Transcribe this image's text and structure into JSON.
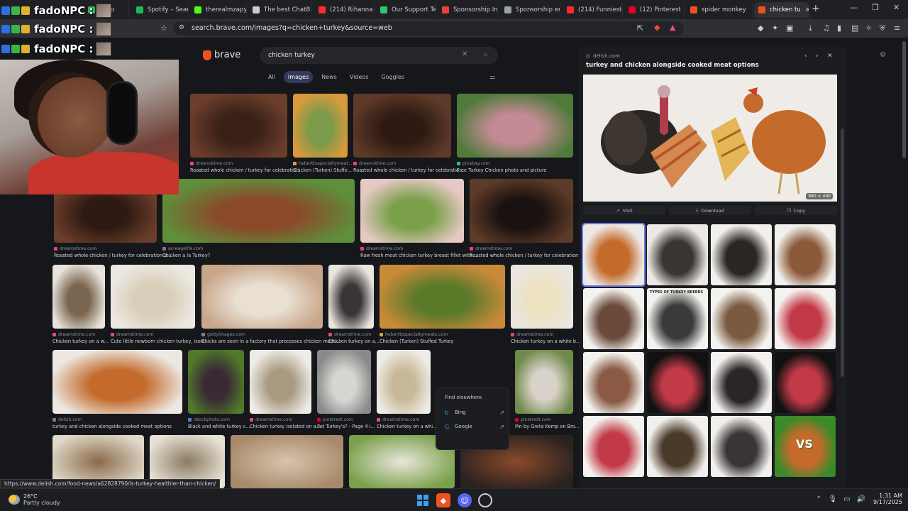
{
  "browser": {
    "tabs": [
      {
        "label": "sApp",
        "icon": "whatsapp-icon",
        "color": "#2fb65f"
      },
      {
        "label": "Spotify – Search",
        "icon": "spotify-icon",
        "color": "#1db954"
      },
      {
        "label": "therealmzapy S",
        "icon": "kick-icon",
        "color": "#53fc18"
      },
      {
        "label": "The best ChatB",
        "icon": "chatbot-icon",
        "color": "#cccccc"
      },
      {
        "label": "(214) Rihanna",
        "icon": "youtube-icon",
        "color": "#ff2b2b"
      },
      {
        "label": "Our Support Te",
        "icon": "support-icon",
        "color": "#32c36c"
      },
      {
        "label": "Sponsorship In",
        "icon": "gmail-icon",
        "color": "#ea4335"
      },
      {
        "label": "Sponsorship en",
        "icon": "globe-icon",
        "color": "#9aa0a6"
      },
      {
        "label": "(214) Funniest",
        "icon": "youtube-icon",
        "color": "#ff2b2b"
      },
      {
        "label": "(12) Pinterest",
        "icon": "pinterest-icon",
        "color": "#e60023"
      },
      {
        "label": "spider monkey",
        "icon": "brave-search-icon",
        "color": "#f0521f"
      },
      {
        "label": "chicken tu",
        "icon": "brave-search-icon",
        "color": "#f0521f",
        "active": true
      }
    ],
    "new_tab": "+",
    "window_controls": [
      "—",
      "❐",
      "✕"
    ],
    "url": "search.brave.com/images?q=chicken+turkey&source=web"
  },
  "overlay": {
    "name": "fadoNPC :"
  },
  "brave": {
    "logo_text": "brave",
    "query": "chicken turkey",
    "filters": [
      "All",
      "Images",
      "News",
      "Videos",
      "Goggles"
    ],
    "active_filter": "Images"
  },
  "results": [
    {
      "src": "dreamstime.com",
      "title": "Roasted whole chicken / turkey for celebratio...",
      "src_color": "#e8467c"
    },
    {
      "src": "heberttsspecialtymeat...",
      "title": "Chicken (Turken) Stuffe...",
      "src_color": "#d9a23a"
    },
    {
      "src": "dreamstime.com",
      "title": "Roasted whole chicken / turkey for celebratio...",
      "src_color": "#e8467c"
    },
    {
      "src": "pixabay.com",
      "title": "Free Turkey Chicken photo and picture",
      "src_color": "#2ec66d"
    },
    {
      "src": "dreamstime.com",
      "title": "Roasted whole chicken / turkey for celebration a...",
      "src_color": "#e8467c"
    },
    {
      "src": "acreagelife.com",
      "title": "Chicken a la Turkey?",
      "src_color": "#7a7d83"
    },
    {
      "src": "dreamstime.com",
      "title": "Raw fresh meat chicken turkey breast fillet with ...",
      "src_color": "#e8467c"
    },
    {
      "src": "dreamstime.com",
      "title": "Roasted whole chicken / turkey for celebration a...",
      "src_color": "#e8467c"
    },
    {
      "src": "dreamstime.com",
      "title": "Chicken turkey on a w...",
      "src_color": "#e8467c"
    },
    {
      "src": "dreamstime.com",
      "title": "Cute little newborn chicken turkey, isola...",
      "src_color": "#e8467c"
    },
    {
      "src": "gettyimages.com",
      "title": "Chicks are seen in a factory that processes chicken meat...",
      "src_color": "#7a7d83"
    },
    {
      "src": "dreamstime.com",
      "title": "Chicken turkey on a...",
      "src_color": "#e8467c"
    },
    {
      "src": "heberttsspecialtymeats.com",
      "title": "Chicken (Turken) Stuffed Turkey",
      "src_color": "#d9a23a"
    },
    {
      "src": "dreamstime.com",
      "title": "Chicken turkey on a white b...",
      "src_color": "#e8467c"
    },
    {
      "src": "delish.com",
      "title": "turkey and chicken alongside cooked meat options",
      "src_color": "#7a7d83"
    },
    {
      "src": "istockphoto.com",
      "title": "Black and white turkey c...",
      "src_color": "#5a7bd8"
    },
    {
      "src": "dreamstime.com",
      "title": "Chicken turkey isolated on a...",
      "src_color": "#e8467c"
    },
    {
      "src": "pinterest.com",
      "title": "Pet Turkey's? - Page 4 i...",
      "src_color": "#e60023"
    },
    {
      "src": "dreamstime.com",
      "title": "Chicken turkey on a whi...",
      "src_color": "#e8467c"
    },
    {
      "src": "pinterest.com",
      "title": "Pin by Greta Kemp on Bro...",
      "src_color": "#e60023"
    }
  ],
  "find_elsewhere": {
    "title": "Find elsewhere",
    "engines": [
      "Bing",
      "Google"
    ]
  },
  "preview": {
    "domain": "delish.com",
    "title": "turkey and chicken alongside cooked meat options",
    "dimensions": "980 × 490",
    "actions": [
      "Visit",
      "Download",
      "Copy"
    ],
    "vs_label": "VS",
    "breeds_label": "TYPES OF TURKEY BREEDS"
  },
  "status_url": "https://www.delish.com/food-news/a62828790/is-turkey-healthier-than-chicken/",
  "taskbar": {
    "temperature": "26°C",
    "weather": "Partly cloudy",
    "time": "1:31 AM",
    "date": "9/17/2025"
  }
}
